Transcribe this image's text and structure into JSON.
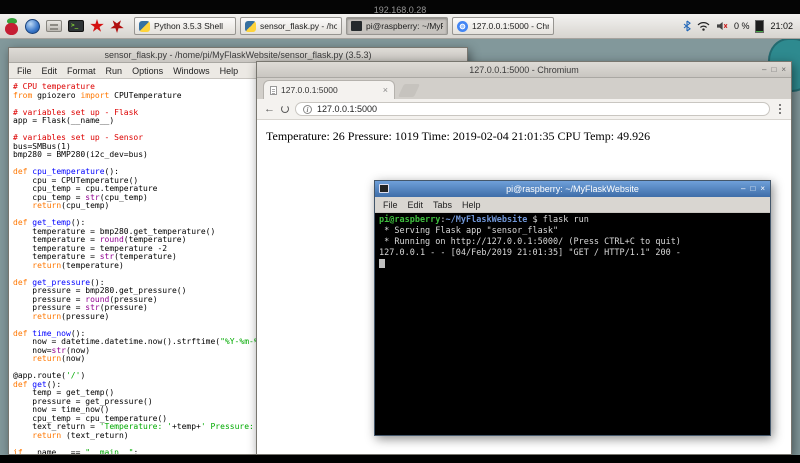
{
  "statusbar": {
    "ip": "192.168.0.28"
  },
  "palette": {
    "desktop": "#82989b",
    "titlebar_blue": "#4a7fc1",
    "syntax_comment": "#dd0000",
    "syntax_keyword": "#ff7700",
    "syntax_string": "#00aa00",
    "syntax_defname": "#0000ff",
    "syntax_builtin": "#900090",
    "terminal_green": "#3fbf3f",
    "terminal_blue": "#7096d8"
  },
  "taskbar": {
    "launchers": [
      "raspberry-menu-icon",
      "web-browser-icon",
      "file-manager-icon",
      "terminal-launcher-icon",
      "wolfram-icon",
      "mathematica-icon"
    ],
    "tasks": [
      {
        "label": "Python 3.5.3 Shell",
        "icon": "python",
        "active": false
      },
      {
        "label": "sensor_flask.py - /ho...",
        "icon": "python",
        "active": false
      },
      {
        "label": "pi@raspberry: ~/MyFl...",
        "icon": "terminal",
        "active": true
      },
      {
        "label": "127.0.0.1:5000 - Chro...",
        "icon": "chromium",
        "active": false
      }
    ],
    "tray": {
      "icons": [
        "bluetooth-icon",
        "wifi-icon",
        "volume-muted-icon"
      ],
      "cpu": "0 %",
      "clock": "21:02"
    }
  },
  "idle": {
    "title": "sensor_flask.py - /home/pi/MyFlaskWebsite/sensor_flask.py (3.5.3)",
    "menus": [
      "File",
      "Edit",
      "Format",
      "Run",
      "Options",
      "Windows",
      "Help"
    ],
    "code": [
      [
        {
          "c": "com",
          "t": "# CPU temperature"
        }
      ],
      [
        {
          "c": "kw",
          "t": "from"
        },
        {
          "c": "txt",
          "t": " gpiozero "
        },
        {
          "c": "kw",
          "t": "import"
        },
        {
          "c": "txt",
          "t": " CPUTemperature"
        }
      ],
      [],
      [
        {
          "c": "com",
          "t": "# variables set up - Flask"
        }
      ],
      [
        {
          "c": "txt",
          "t": "app = Flask(__name__)"
        }
      ],
      [],
      [
        {
          "c": "com",
          "t": "# variables set up - Sensor"
        }
      ],
      [
        {
          "c": "txt",
          "t": "bus=SMBus(1)"
        }
      ],
      [
        {
          "c": "txt",
          "t": "bmp280 = BMP280(i2c_dev=bus)"
        }
      ],
      [],
      [
        {
          "c": "kw",
          "t": "def"
        },
        {
          "c": "txt",
          "t": " "
        },
        {
          "c": "fn",
          "t": "cpu_temperature"
        },
        {
          "c": "txt",
          "t": "():"
        }
      ],
      [
        {
          "c": "txt",
          "t": "    cpu = CPUTemperature()"
        }
      ],
      [
        {
          "c": "txt",
          "t": "    cpu_temp = cpu.temperature"
        }
      ],
      [
        {
          "c": "txt",
          "t": "    cpu_temp = "
        },
        {
          "c": "blt",
          "t": "str"
        },
        {
          "c": "txt",
          "t": "(cpu_temp)"
        }
      ],
      [
        {
          "c": "txt",
          "t": "    "
        },
        {
          "c": "kw",
          "t": "return"
        },
        {
          "c": "txt",
          "t": "(cpu_temp)"
        }
      ],
      [],
      [
        {
          "c": "kw",
          "t": "def"
        },
        {
          "c": "txt",
          "t": " "
        },
        {
          "c": "fn",
          "t": "get_temp"
        },
        {
          "c": "txt",
          "t": "():"
        }
      ],
      [
        {
          "c": "txt",
          "t": "    temperature = bmp280.get_temperature()"
        }
      ],
      [
        {
          "c": "txt",
          "t": "    temperature = "
        },
        {
          "c": "blt",
          "t": "round"
        },
        {
          "c": "txt",
          "t": "(temperature)"
        }
      ],
      [
        {
          "c": "txt",
          "t": "    temperature = temperature -2"
        }
      ],
      [
        {
          "c": "txt",
          "t": "    temperature = "
        },
        {
          "c": "blt",
          "t": "str"
        },
        {
          "c": "txt",
          "t": "(temperature)"
        }
      ],
      [
        {
          "c": "txt",
          "t": "    "
        },
        {
          "c": "kw",
          "t": "return"
        },
        {
          "c": "txt",
          "t": "(temperature)"
        }
      ],
      [],
      [
        {
          "c": "kw",
          "t": "def"
        },
        {
          "c": "txt",
          "t": " "
        },
        {
          "c": "fn",
          "t": "get_pressure"
        },
        {
          "c": "txt",
          "t": "():"
        }
      ],
      [
        {
          "c": "txt",
          "t": "    pressure = bmp280.get_pressure()"
        }
      ],
      [
        {
          "c": "txt",
          "t": "    pressure = "
        },
        {
          "c": "blt",
          "t": "round"
        },
        {
          "c": "txt",
          "t": "(pressure)"
        }
      ],
      [
        {
          "c": "txt",
          "t": "    pressure = "
        },
        {
          "c": "blt",
          "t": "str"
        },
        {
          "c": "txt",
          "t": "(pressure)"
        }
      ],
      [
        {
          "c": "txt",
          "t": "    "
        },
        {
          "c": "kw",
          "t": "return"
        },
        {
          "c": "txt",
          "t": "(pressure)"
        }
      ],
      [],
      [
        {
          "c": "kw",
          "t": "def"
        },
        {
          "c": "txt",
          "t": " "
        },
        {
          "c": "fn",
          "t": "time_now"
        },
        {
          "c": "txt",
          "t": "():"
        }
      ],
      [
        {
          "c": "txt",
          "t": "    now = datetime.datetime.now().strftime("
        },
        {
          "c": "str",
          "t": "\"%Y-%m-%d"
        }
      ],
      [
        {
          "c": "txt",
          "t": "    now="
        },
        {
          "c": "blt",
          "t": "str"
        },
        {
          "c": "txt",
          "t": "(now)"
        }
      ],
      [
        {
          "c": "txt",
          "t": "    "
        },
        {
          "c": "kw",
          "t": "return"
        },
        {
          "c": "txt",
          "t": "(now)"
        }
      ],
      [],
      [
        {
          "c": "txt",
          "t": "@app.route("
        },
        {
          "c": "str",
          "t": "'/'"
        },
        {
          "c": "txt",
          "t": ")"
        }
      ],
      [
        {
          "c": "kw",
          "t": "def"
        },
        {
          "c": "txt",
          "t": " "
        },
        {
          "c": "fn",
          "t": "get"
        },
        {
          "c": "txt",
          "t": "():"
        }
      ],
      [
        {
          "c": "txt",
          "t": "    temp = get_temp()"
        }
      ],
      [
        {
          "c": "txt",
          "t": "    pressure = get_pressure()"
        }
      ],
      [
        {
          "c": "txt",
          "t": "    now = time_now()"
        }
      ],
      [
        {
          "c": "txt",
          "t": "    cpu_temp = cpu_temperature()"
        }
      ],
      [
        {
          "c": "txt",
          "t": "    text_return = "
        },
        {
          "c": "str",
          "t": "'Temperature: '"
        },
        {
          "c": "txt",
          "t": "+temp+"
        },
        {
          "c": "str",
          "t": "' Pressure: '"
        },
        {
          "c": "txt",
          "t": "+"
        }
      ],
      [
        {
          "c": "txt",
          "t": "    "
        },
        {
          "c": "kw",
          "t": "return"
        },
        {
          "c": "txt",
          "t": " (text_return)"
        }
      ],
      [],
      [
        {
          "c": "kw",
          "t": "if"
        },
        {
          "c": "txt",
          "t": " __name__ == "
        },
        {
          "c": "str",
          "t": "\"__main__\""
        },
        {
          "c": "txt",
          "t": ":"
        }
      ]
    ]
  },
  "chromium": {
    "title": "127.0.0.1:5000 - Chromium",
    "tab": "127.0.0.1:5000",
    "url": "127.0.0.1:5000",
    "content": "Temperature: 26 Pressure: 1019 Time: 2019-02-04 21:01:35 CPU Temp: 49.926"
  },
  "terminal": {
    "title": "pi@raspberry: ~/MyFlaskWebsite",
    "menus": [
      "File",
      "Edit",
      "Tabs",
      "Help"
    ],
    "lines": [
      [
        {
          "c": "tg",
          "t": "pi@raspberry"
        },
        {
          "c": "tw",
          "t": ":"
        },
        {
          "c": "tb",
          "t": "~/MyFlaskWebsite"
        },
        {
          "c": "tw",
          "t": " $ flask run"
        }
      ],
      [
        {
          "c": "tw",
          "t": " * Serving Flask app \"sensor_flask\""
        }
      ],
      [
        {
          "c": "tw",
          "t": " * Running on http://127.0.0.1:5000/ (Press CTRL+C to quit)"
        }
      ],
      [
        {
          "c": "tw",
          "t": "127.0.0.1 - - [04/Feb/2019 21:01:35] \"GET / HTTP/1.1\" 200 -"
        }
      ],
      [
        {
          "c": "cursor",
          "t": " "
        }
      ]
    ]
  }
}
